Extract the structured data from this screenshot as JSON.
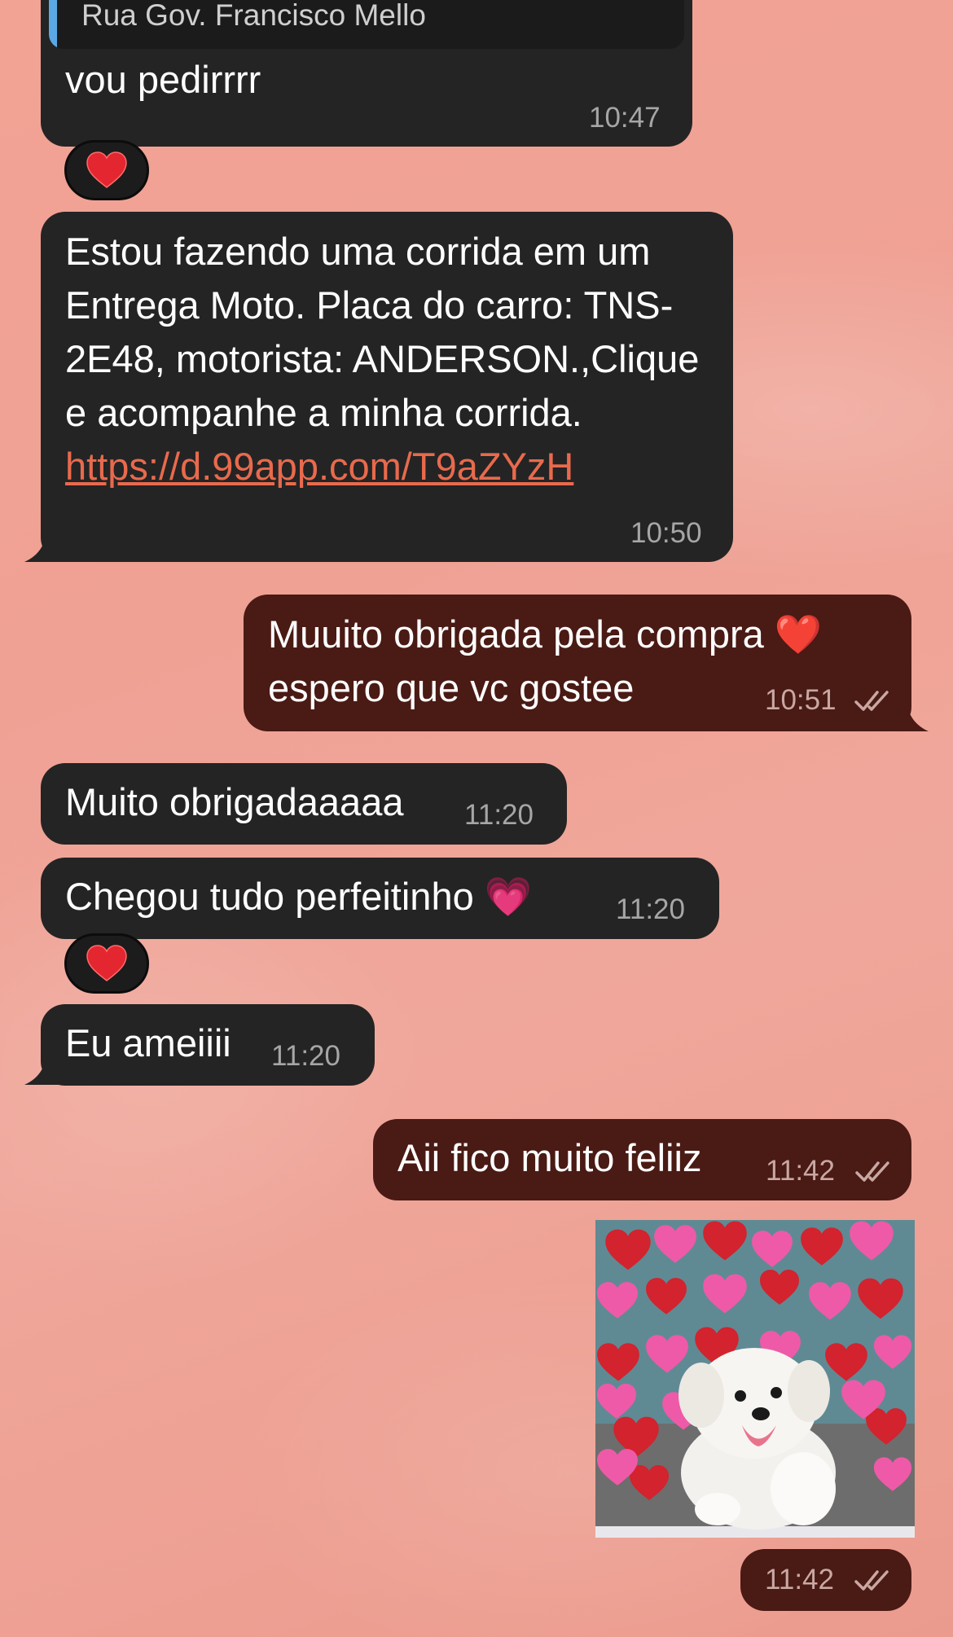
{
  "messages": {
    "m1": {
      "quote_text": "Rua Gov. Francisco Mello",
      "text": "vou pedirrrr",
      "time": "10:47",
      "reaction": "heart"
    },
    "m2": {
      "text": "Estou fazendo uma corrida em um Entrega Moto. Placa do carro: TNS-2E48, motorista: ANDERSON.,Clique e acompanhe a minha corrida. ",
      "link": "https://d.99app.com/T9aZYzH",
      "time": "10:50"
    },
    "m3": {
      "text": "Muuito obrigada pela compra ❤️ espero que vc gostee",
      "time": "10:51",
      "status": "read"
    },
    "m4": {
      "text": "Muito obrigadaaaaa",
      "time": "11:20"
    },
    "m5": {
      "text": "Chegou tudo perfeitinho 💗",
      "time": "11:20",
      "reaction": "heart"
    },
    "m6": {
      "text": "Eu ameiiii",
      "time": "11:20"
    },
    "m7": {
      "text": "Aii fico muito feliiz",
      "time": "11:42",
      "status": "read"
    },
    "m8": {
      "media": "sticker",
      "time": "11:42",
      "status": "read"
    }
  },
  "colors": {
    "incoming_bubble": "#242424",
    "outgoing_bubble": "#4a1a14",
    "link": "#e86a4d",
    "quote_accent": "#5aa9e6",
    "background": "#f0a597"
  },
  "icons": {
    "reaction": "heart-icon",
    "status": "double-check-icon"
  }
}
